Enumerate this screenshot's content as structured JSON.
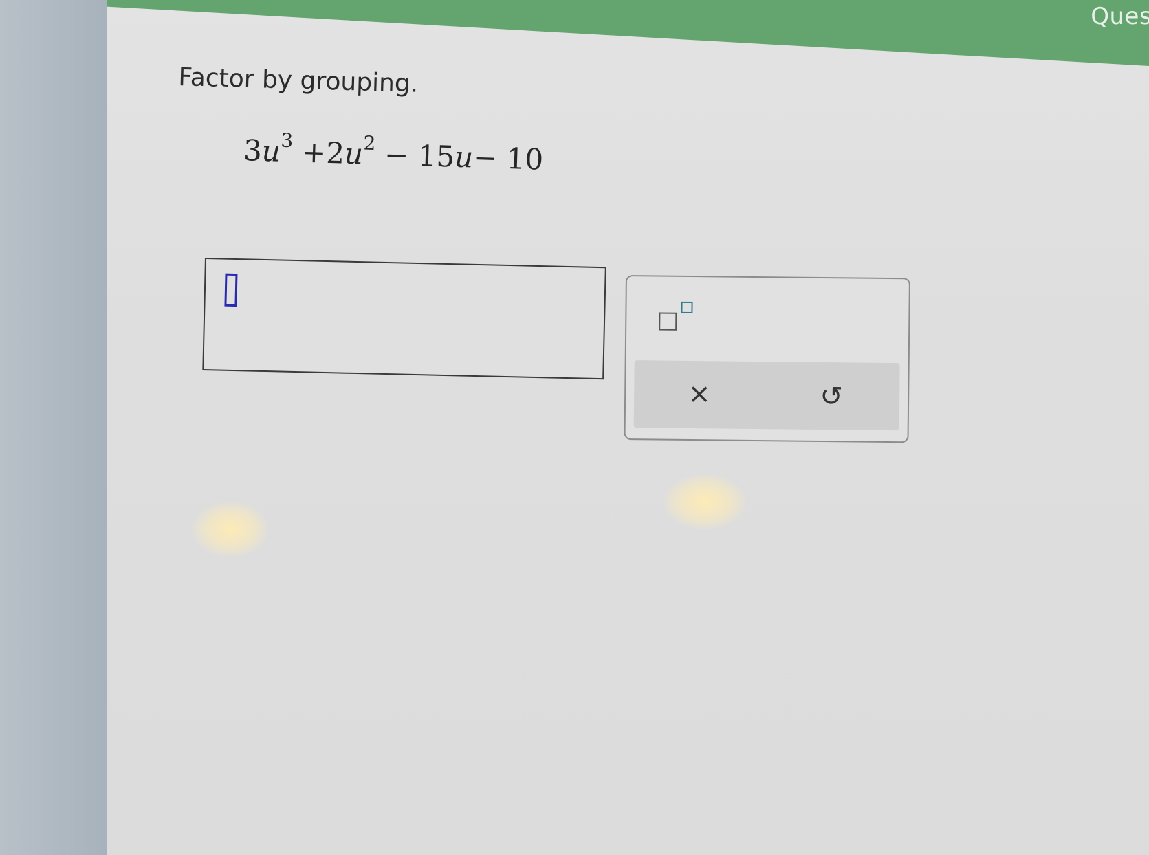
{
  "header": {
    "tab_label": "Quest"
  },
  "question": {
    "prompt": "Factor by grouping.",
    "expression": {
      "term1_coef": "3",
      "term1_var": "u",
      "term1_exp": "3",
      "op1": " +",
      "term2_coef": "2",
      "term2_var": "u",
      "term2_exp": "2",
      "op2": " − ",
      "term3_coef": "15",
      "term3_var": "u",
      "op3": "− ",
      "term4": "10"
    }
  },
  "answer": {
    "value": ""
  },
  "keypad": {
    "exponent_icon": "superscript-template-icon",
    "clear_symbol": "×",
    "undo_symbol": "↺"
  },
  "colors": {
    "header_green": "#64a56f",
    "cursor_blue": "#2a2ab0",
    "exponent_teal": "#2f7d8a"
  }
}
